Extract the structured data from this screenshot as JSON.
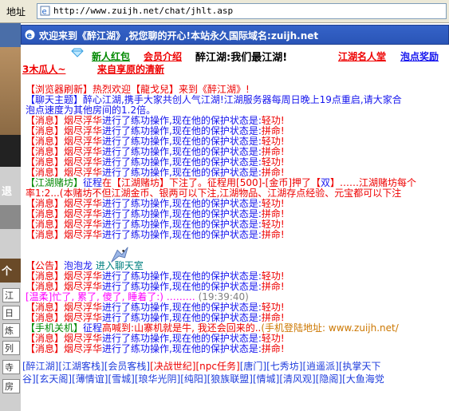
{
  "address_bar": {
    "label": "地址",
    "url": "http://www.zuijh.net/chat/jhlt.asp"
  },
  "left_strip": {
    "text1": "退",
    "text2": "个",
    "items": [
      "江",
      "日",
      "炼",
      "列",
      "寺",
      "房"
    ]
  },
  "title_bar": {
    "text": "欢迎来到《醉江湖》,祝您聊的开心!本站永久国际域名:zuijh.net"
  },
  "nav": {
    "newbie_gift": "新人红包",
    "vip_intro": "会员介绍",
    "slogan": "醉江湖:我们最江湖!",
    "famous": "江湖名人堂",
    "bubble_reward": "泡点奖励",
    "left_tag": "3木瓜人~",
    "update_text": "来自享原的清新"
  },
  "chat": {
    "lines": [
      {
        "segments": [
          {
            "c": "red",
            "t": "【浏览器刷新】热烈欢迎【龍戈兒】来到《醉江湖》!"
          }
        ]
      },
      {
        "segments": [
          {
            "c": "blu",
            "t": "【聊天主题】醉心江湖,携手大家共创人气江湖!江湖服务器每周日晚上19点重启,请大家合"
          }
        ]
      },
      {
        "segments": [
          {
            "c": "blu",
            "t": "泡点速度为其他房间的1.2倍。"
          }
        ]
      },
      {
        "segments": [
          {
            "c": "red",
            "t": "【消息】"
          },
          {
            "c": "red",
            "t": "烟尽浮华"
          },
          {
            "c": "blu",
            "t": "进行了练功操作,现在他的保护状态是:"
          },
          {
            "c": "red",
            "t": "轻功!"
          }
        ]
      },
      {
        "segments": [
          {
            "c": "red",
            "t": "【消息】"
          },
          {
            "c": "red",
            "t": "烟尽浮华"
          },
          {
            "c": "blu",
            "t": "进行了练功操作,现在他的保护状态是:"
          },
          {
            "c": "red",
            "t": "拼命!"
          }
        ]
      },
      {
        "segments": [
          {
            "c": "red",
            "t": "【消息】"
          },
          {
            "c": "red",
            "t": "烟尽浮华"
          },
          {
            "c": "blu",
            "t": "进行了练功操作,现在他的保护状态是:"
          },
          {
            "c": "red",
            "t": "轻功!"
          }
        ]
      },
      {
        "segments": [
          {
            "c": "red",
            "t": "【消息】"
          },
          {
            "c": "red",
            "t": "烟尽浮华"
          },
          {
            "c": "blu",
            "t": "进行了练功操作,现在他的保护状态是:"
          },
          {
            "c": "red",
            "t": "拼命!"
          }
        ]
      },
      {
        "segments": [
          {
            "c": "red",
            "t": "【消息】"
          },
          {
            "c": "red",
            "t": "烟尽浮华"
          },
          {
            "c": "blu",
            "t": "进行了练功操作,现在他的保护状态是:"
          },
          {
            "c": "red",
            "t": "轻功!"
          }
        ]
      },
      {
        "segments": [
          {
            "c": "red",
            "t": "【消息】"
          },
          {
            "c": "red",
            "t": "烟尽浮华"
          },
          {
            "c": "blu",
            "t": "进行了练功操作,现在他的保护状态是:"
          },
          {
            "c": "red",
            "t": "拼命!"
          }
        ]
      },
      {
        "segments": [
          {
            "c": "grn",
            "t": "【江湖赌坊】"
          },
          {
            "c": "blu",
            "t": "征程"
          },
          {
            "c": "red",
            "t": "在【江湖赌坊】下注了。征程用["
          },
          {
            "c": "red",
            "t": "500"
          },
          {
            "c": "red",
            "t": "]-["
          },
          {
            "c": "red",
            "t": "金币"
          },
          {
            "c": "red",
            "t": "]押了【"
          },
          {
            "c": "blu",
            "t": "双"
          },
          {
            "c": "red",
            "t": "】……江湖赌坊每个"
          }
        ]
      },
      {
        "segments": [
          {
            "c": "red",
            "t": "率1:2...(本赌坊不但江湖金币、银两可以下注,江湖物品、江湖存点经验、元宝都可以下注"
          }
        ]
      },
      {
        "segments": [
          {
            "c": "red",
            "t": "【消息】"
          },
          {
            "c": "red",
            "t": "烟尽浮华"
          },
          {
            "c": "blu",
            "t": "进行了练功操作,现在他的保护状态是:"
          },
          {
            "c": "red",
            "t": "轻功!"
          }
        ]
      },
      {
        "segments": [
          {
            "c": "red",
            "t": "【消息】"
          },
          {
            "c": "red",
            "t": "烟尽浮华"
          },
          {
            "c": "blu",
            "t": "进行了练功操作,现在他的保护状态是:"
          },
          {
            "c": "red",
            "t": "拼命!"
          }
        ]
      },
      {
        "segments": [
          {
            "c": "red",
            "t": "【消息】"
          },
          {
            "c": "red",
            "t": "烟尽浮华"
          },
          {
            "c": "blu",
            "t": "进行了练功操作,现在他的保护状态是:"
          },
          {
            "c": "red",
            "t": "轻功!"
          }
        ]
      },
      {
        "segments": [
          {
            "c": "red",
            "t": "【消息】"
          },
          {
            "c": "red",
            "t": "烟尽浮华"
          },
          {
            "c": "blu",
            "t": "进行了练功操作,现在他的保护状态是:"
          },
          {
            "c": "red",
            "t": "拼命!"
          }
        ]
      },
      {
        "segments": [
          {
            "c": "red",
            "t": ""
          }
        ]
      },
      {
        "segments": [
          {
            "c": "red",
            "t": ""
          }
        ]
      },
      {
        "segments": [
          {
            "c": "red",
            "t": "【公告】"
          },
          {
            "c": "blu",
            "t": "泡泡龙"
          },
          {
            "c": "teal",
            "t": "       进入聊天室"
          }
        ]
      },
      {
        "segments": [
          {
            "c": "red",
            "t": "【消息】"
          },
          {
            "c": "red",
            "t": "烟尽浮华"
          },
          {
            "c": "blu",
            "t": "进行了练功操作,现在他的保护状态是:"
          },
          {
            "c": "red",
            "t": "轻功!"
          }
        ]
      },
      {
        "segments": [
          {
            "c": "red",
            "t": "【消息】"
          },
          {
            "c": "red",
            "t": "烟尽浮华"
          },
          {
            "c": "blu",
            "t": "进行了练功操作,现在他的保护状态是:"
          },
          {
            "c": "red",
            "t": "拼命!"
          }
        ]
      },
      {
        "segments": [
          {
            "c": "mag",
            "t": "[温柔]忙了, 累了, 傻了, 睡着了:)  ……… "
          },
          {
            "c": "gray",
            "t": "(19:39:40)"
          }
        ]
      },
      {
        "segments": [
          {
            "c": "red",
            "t": "【消息】"
          },
          {
            "c": "red",
            "t": "烟尽浮华"
          },
          {
            "c": "blu",
            "t": "进行了练功操作,现在他的保护状态是:"
          },
          {
            "c": "red",
            "t": "轻功!"
          }
        ]
      },
      {
        "segments": [
          {
            "c": "red",
            "t": "【消息】"
          },
          {
            "c": "red",
            "t": "烟尽浮华"
          },
          {
            "c": "blu",
            "t": "进行了练功操作,现在他的保护状态是:"
          },
          {
            "c": "red",
            "t": "拼命!"
          }
        ]
      },
      {
        "segments": [
          {
            "c": "grn",
            "t": "【手机关机】"
          },
          {
            "c": "blu",
            "t": "征程"
          },
          {
            "c": "red",
            "t": "高喊到:山寨机就是牛, 我还会回来的.."
          },
          {
            "c": "orange",
            "t": "(手机登陆地址: www.zuijh.net/"
          }
        ]
      },
      {
        "segments": [
          {
            "c": "red",
            "t": "【消息】"
          },
          {
            "c": "red",
            "t": "烟尽浮华"
          },
          {
            "c": "blu",
            "t": "进行了练功操作,现在他的保护状态是:"
          },
          {
            "c": "red",
            "t": "轻功!"
          }
        ]
      },
      {
        "segments": [
          {
            "c": "red",
            "t": "【消息】"
          },
          {
            "c": "red",
            "t": "烟尽浮华"
          },
          {
            "c": "blu",
            "t": "进行了练功操作,现在他的保护状态是:"
          },
          {
            "c": "red",
            "t": "拼命!"
          }
        ]
      }
    ]
  },
  "footer": {
    "row1": [
      "[醉江湖]",
      "[江湖客栈]",
      "[会员客栈]",
      "[决战世纪]",
      "[npc任务]",
      "[唐门]",
      "[七秀坊]",
      "[逍遥派]",
      "[执掌天下"
    ],
    "row2": [
      "谷]",
      "[玄天阁]",
      "[薄情谊]",
      "[雪城]",
      "[琅华光阴]",
      "[纯阳]",
      "[狼族联盟]",
      "[情城]",
      "[清风观]",
      "[隐阁]",
      "[大鱼海党"
    ]
  },
  "colors": {
    "title_bar": "#2a55b7",
    "address_bar": "#ece9d8",
    "link_blue": "#1e3cdd",
    "alert_red": "#ee0000",
    "green": "#008800"
  }
}
